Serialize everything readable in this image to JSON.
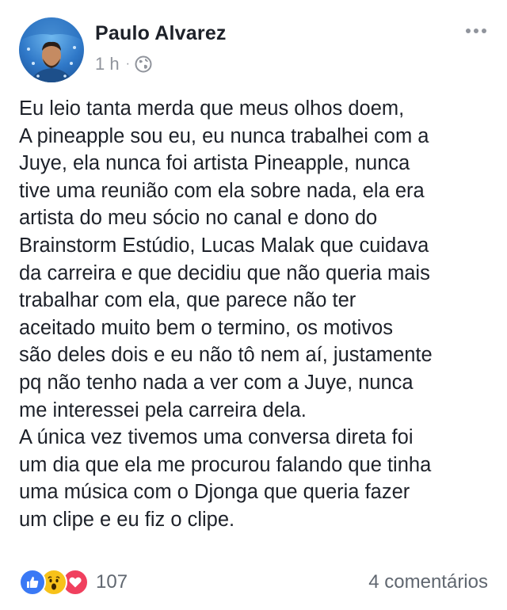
{
  "post": {
    "author": "Paulo Alvarez",
    "time": "1 h",
    "separator": "·",
    "privacy_icon": "globe-icon",
    "menu_icon": "more-options-icon",
    "body_lines": [
      "Eu leio tanta merda que meus olhos doem,",
      "A pineapple sou eu, eu nunca trabalhei com a",
      "Juye, ela nunca foi artista Pineapple, nunca",
      "tive uma reunião com ela sobre nada, ela era",
      "artista do meu sócio no canal e dono do",
      "Brainstorm Estúdio, Lucas Malak que cuidava",
      "da carreira e que decidiu que não queria mais",
      "trabalhar com ela, que parece não ter",
      "aceitado muito bem o termino, os motivos",
      "são deles dois e eu não tô nem aí, justamente",
      "pq não tenho nada a ver com a Juye, nunca",
      "me interessei pela carreira dela.",
      "A única vez tivemos uma conversa direta foi",
      "um dia que ela me procurou falando que tinha",
      "uma música com o Djonga que queria fazer",
      "um clipe e eu fiz o clipe."
    ]
  },
  "footer": {
    "reactions": [
      "like-icon",
      "wow-icon",
      "love-icon"
    ],
    "reaction_count": "107",
    "comments": "4 comentários"
  },
  "colors": {
    "like": "#3a79f5",
    "wow": "#f7c21a",
    "love": "#f0405e",
    "meta": "#90949c"
  }
}
